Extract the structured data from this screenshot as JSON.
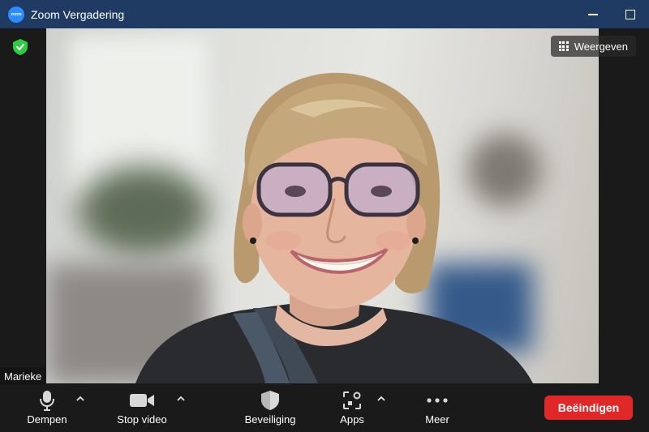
{
  "window": {
    "title": "Zoom Vergadering",
    "logo_text": "zoom",
    "icons": {
      "minimize": "minimize-icon",
      "maximize": "maximize-icon"
    }
  },
  "video": {
    "view_label": "Weergeven",
    "participant_name": "Marieke",
    "security_badge": "shield-check-icon"
  },
  "toolbar": {
    "mute_label": "Dempen",
    "video_label": "Stop video",
    "security_label": "Beveiliging",
    "apps_label": "Apps",
    "more_label": "Meer",
    "end_label": "Beëindigen"
  },
  "colors": {
    "titlebar": "#1f3b63",
    "end_button": "#e02828",
    "badge_green": "#2ecc40",
    "background": "#1a1a1a"
  }
}
